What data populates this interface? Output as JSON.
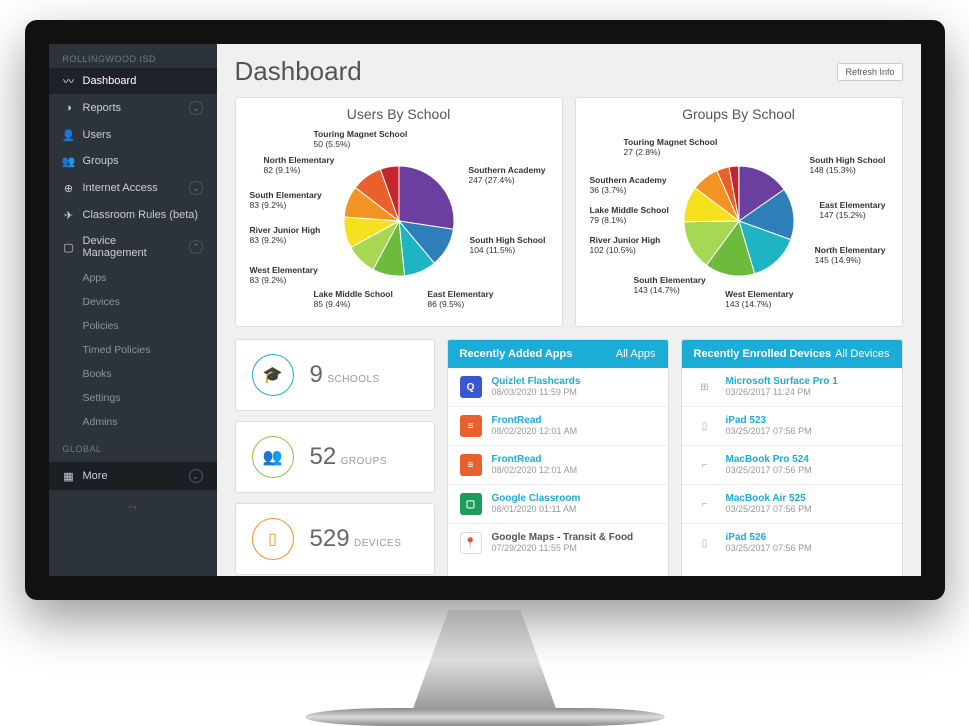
{
  "org_name": "ROLLINGWOOD ISD",
  "global_label": "GLOBAL",
  "page_title": "Dashboard",
  "refresh_label": "Refresh Info",
  "sidebar": {
    "items": [
      {
        "label": "Dashboard",
        "icon": "chart-line-icon",
        "active": true
      },
      {
        "label": "Reports",
        "icon": "pie-icon",
        "expandable": true
      },
      {
        "label": "Users",
        "icon": "user-icon"
      },
      {
        "label": "Groups",
        "icon": "users-icon"
      },
      {
        "label": "Internet Access",
        "icon": "globe-icon",
        "expandable": true
      },
      {
        "label": "Classroom Rules (beta)",
        "icon": "plane-icon"
      },
      {
        "label": "Device Management",
        "icon": "device-icon",
        "expandable": true,
        "expanded": true
      }
    ],
    "device_sub": [
      "Apps",
      "Devices",
      "Policies",
      "Timed Policies",
      "Books",
      "Settings",
      "Admins"
    ],
    "more_label": "More"
  },
  "chart_data": [
    {
      "type": "pie",
      "title": "Users By School",
      "series": [
        {
          "name": "Southern Academy",
          "value": 247,
          "pct": 27.4,
          "color": "#6b3fa0"
        },
        {
          "name": "South High School",
          "value": 104,
          "pct": 11.5,
          "color": "#2c7fb8"
        },
        {
          "name": "East Elementary",
          "value": 86,
          "pct": 9.5,
          "color": "#1fb4c4"
        },
        {
          "name": "Lake Middle School",
          "value": 85,
          "pct": 9.4,
          "color": "#6dbb3c"
        },
        {
          "name": "West Elementary",
          "value": 83,
          "pct": 9.2,
          "color": "#a6d854"
        },
        {
          "name": "River Junior High",
          "value": 83,
          "pct": 9.2,
          "color": "#f7e11e"
        },
        {
          "name": "South Elementary",
          "value": 83,
          "pct": 9.2,
          "color": "#f39323"
        },
        {
          "name": "North Elementary",
          "value": 82,
          "pct": 9.1,
          "color": "#e8602c"
        },
        {
          "name": "Touring Magnet School",
          "value": 50,
          "pct": 5.5,
          "color": "#c1272d"
        }
      ]
    },
    {
      "type": "pie",
      "title": "Groups By School",
      "series": [
        {
          "name": "South High School",
          "value": 148,
          "pct": 15.3,
          "color": "#6b3fa0"
        },
        {
          "name": "East Elementary",
          "value": 147,
          "pct": 15.2,
          "color": "#2c7fb8"
        },
        {
          "name": "North Elementary",
          "value": 145,
          "pct": 14.9,
          "color": "#1fb4c4"
        },
        {
          "name": "West Elementary",
          "value": 143,
          "pct": 14.7,
          "color": "#6dbb3c"
        },
        {
          "name": "South Elementary",
          "value": 143,
          "pct": 14.7,
          "color": "#a6d854"
        },
        {
          "name": "River Junior High",
          "value": 102,
          "pct": 10.5,
          "color": "#f7e11e"
        },
        {
          "name": "Lake Middle School",
          "value": 79,
          "pct": 8.1,
          "color": "#f39323"
        },
        {
          "name": "Southern Academy",
          "value": 36,
          "pct": 3.7,
          "color": "#e8602c"
        },
        {
          "name": "Touring Magnet School",
          "value": 27,
          "pct": 2.8,
          "color": "#c1272d"
        }
      ]
    }
  ],
  "stats": [
    {
      "num": "9",
      "label": "SCHOOLS",
      "color": "#1badd8",
      "icon": "grad-cap-icon"
    },
    {
      "num": "52",
      "label": "GROUPS",
      "color": "#8bc34a",
      "icon": "users-icon"
    },
    {
      "num": "529",
      "label": "DEVICES",
      "color": "#f39323",
      "icon": "tablet-icon"
    }
  ],
  "apps_panel": {
    "title": "Recently Added Apps",
    "all_link": "All Apps",
    "rows": [
      {
        "name": "Quizlet Flashcards",
        "ts": "08/03/2020 11:59 PM",
        "color": "#3957d0",
        "glyph": "Q"
      },
      {
        "name": "FrontRead",
        "ts": "08/02/2020 12:01 AM",
        "color": "#e8602c",
        "glyph": "≡"
      },
      {
        "name": "FrontRead",
        "ts": "08/02/2020 12:01 AM",
        "color": "#e8602c",
        "glyph": "≡"
      },
      {
        "name": "Google Classroom",
        "ts": "08/01/2020 01:11 AM",
        "color": "#1c9e5a",
        "glyph": "▢"
      },
      {
        "name": "Google Maps - Transit & Food",
        "ts": "07/29/2020 11:55 PM",
        "color": "#fff",
        "glyph": "📍",
        "dark": true
      }
    ]
  },
  "devices_panel": {
    "title": "Recently Enrolled Devices",
    "all_link": "All Devices",
    "rows": [
      {
        "name": "Microsoft Surface Pro 1",
        "ts": "03/26/2017 11:24 PM",
        "icon": "windows"
      },
      {
        "name": "iPad 523",
        "ts": "03/25/2017 07:56 PM",
        "icon": "tablet"
      },
      {
        "name": "MacBook Pro 524",
        "ts": "03/25/2017 07:56 PM",
        "icon": "laptop"
      },
      {
        "name": "MacBook Air 525",
        "ts": "03/25/2017 07:56 PM",
        "icon": "laptop"
      },
      {
        "name": "iPad 526",
        "ts": "03/25/2017 07:56 PM",
        "icon": "tablet"
      }
    ]
  }
}
